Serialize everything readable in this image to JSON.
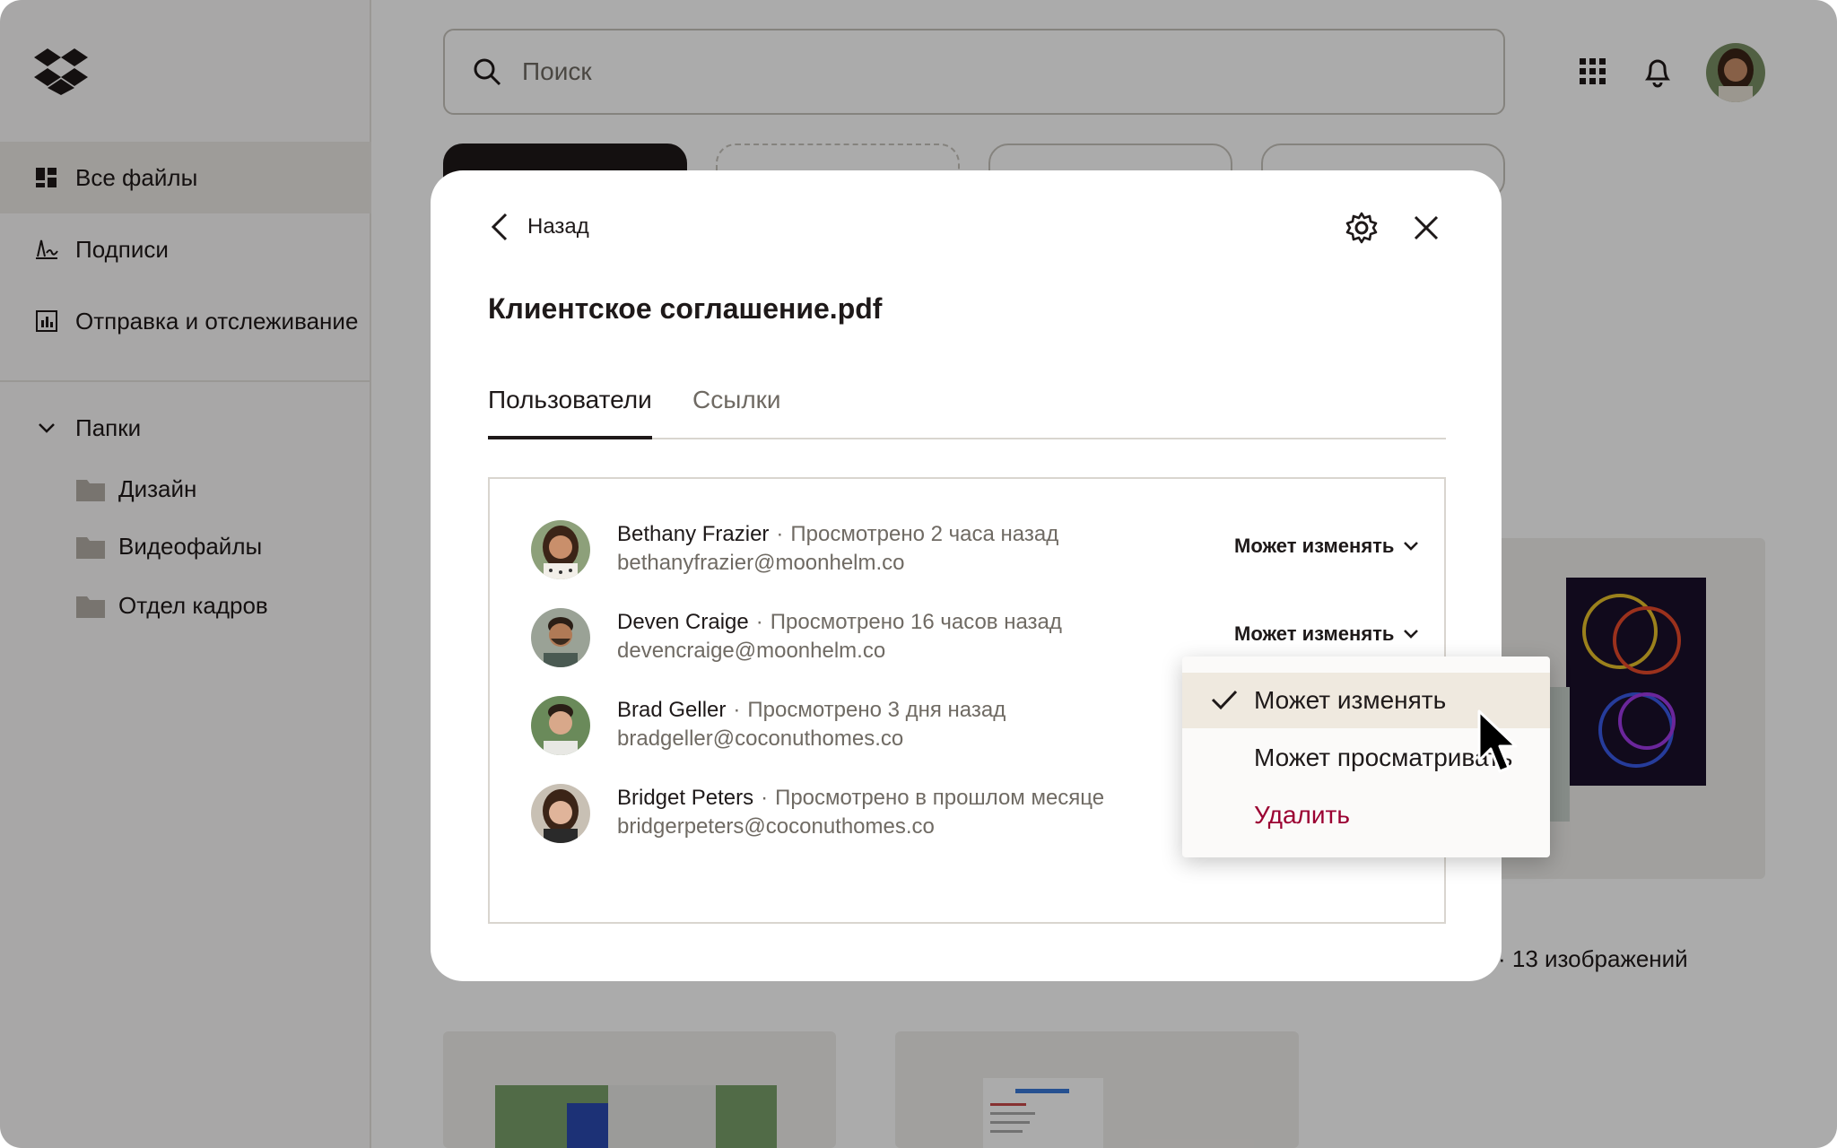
{
  "sidebar": {
    "items": [
      {
        "label": "Все файлы",
        "icon": "all-files-icon"
      },
      {
        "label": "Подписи",
        "icon": "signature-icon"
      },
      {
        "label": "Отправка и отслеживание",
        "icon": "chart-icon"
      }
    ],
    "folders_label": "Папки",
    "folders": [
      {
        "label": "Дизайн"
      },
      {
        "label": "Видеофайлы"
      },
      {
        "label": "Отдел кадров"
      }
    ]
  },
  "search": {
    "placeholder": "Поиск"
  },
  "background": {
    "gallery_meta": "· 13 изображений"
  },
  "modal": {
    "back_label": "Назад",
    "title": "Клиентское соглашение.pdf",
    "tabs": [
      {
        "label": "Пользователи",
        "active": true
      },
      {
        "label": "Ссылки",
        "active": false
      }
    ],
    "users": [
      {
        "name": "Bethany Frazier",
        "meta": "Просмотрено 2 часа назад",
        "email": "bethanyfrazier@moonhelm.co",
        "permission": "Может изменять"
      },
      {
        "name": "Deven Craige",
        "meta": "Просмотрено 16 часов назад",
        "email": "devencraige@moonhelm.co",
        "permission": "Может изменять"
      },
      {
        "name": "Brad Geller",
        "meta": "Просмотрено 3 дня назад",
        "email": "bradgeller@coconuthomes.co",
        "permission": ""
      },
      {
        "name": "Bridget Peters",
        "meta": "Просмотрено в прошлом месяце",
        "email": "bridgerpeters@coconuthomes.co",
        "permission": ""
      }
    ]
  },
  "dropdown": {
    "items": [
      {
        "label": "Может изменять",
        "selected": true
      },
      {
        "label": "Может просматривать",
        "selected": false
      },
      {
        "label": "Удалить",
        "selected": false
      }
    ]
  },
  "colors": {
    "delete": "#9b0032",
    "selected_bg": "#efe9df",
    "accent_dark": "#1e1919"
  }
}
